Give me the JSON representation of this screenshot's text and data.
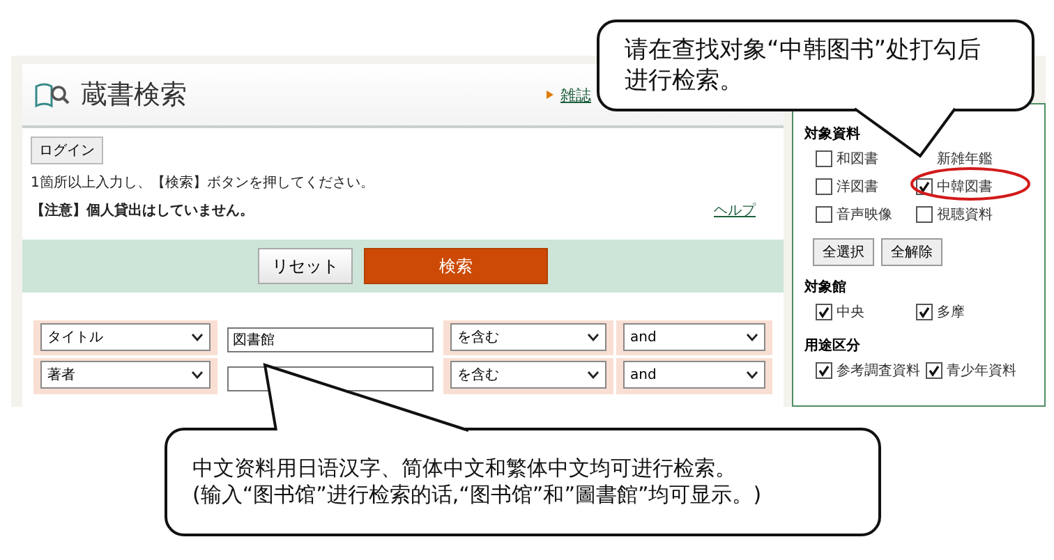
{
  "header": {
    "title": "蔵書検索",
    "link": "雑誌"
  },
  "login_button": "ログイン",
  "instruction": "1箇所以上入力し、【検索】ボタンを押してください。",
  "notice": "【注意】個人貸出はしていません。",
  "help_link": "ヘルプ",
  "buttons": {
    "reset": "リセット",
    "search": "検索"
  },
  "search_rows": [
    {
      "field": "タイトル",
      "value": "図書館",
      "match": "を含む",
      "operator": "and"
    },
    {
      "field": "著者",
      "value": "",
      "match": "を含む",
      "operator": "and"
    }
  ],
  "sidebar": {
    "sections": [
      {
        "kind": "checks",
        "title": "対象資料",
        "items": [
          {
            "label": "和図書",
            "checked": false
          },
          {
            "label": "新雑年鑑"
          },
          {
            "label": "洋図書",
            "checked": false
          },
          {
            "label": "中韓図書",
            "checked": true
          },
          {
            "label": "音声映像",
            "checked": false
          },
          {
            "label": "視聴資料",
            "checked": false
          }
        ],
        "buttons": [
          "全選択",
          "全解除"
        ]
      },
      {
        "kind": "checks",
        "title": "対象館",
        "items": [
          {
            "label": "中央",
            "checked": true
          },
          {
            "label": "多摩",
            "checked": true
          }
        ]
      },
      {
        "kind": "inline",
        "title": "用途区分",
        "items": [
          {
            "label": "参考調査資料",
            "checked": true
          },
          {
            "label": "青少年資料",
            "checked": true
          }
        ]
      }
    ]
  },
  "callouts": [
    {
      "text": "请在查找对象“中韩图书”处打勾后进行检索。"
    },
    {
      "text": "中文资料用日语汉字、简体中文和繁体中文均可进行检索。\n(输入“图书馆”进行检索的话,“图书馆”和”圖書館”均可显示。)"
    }
  ]
}
